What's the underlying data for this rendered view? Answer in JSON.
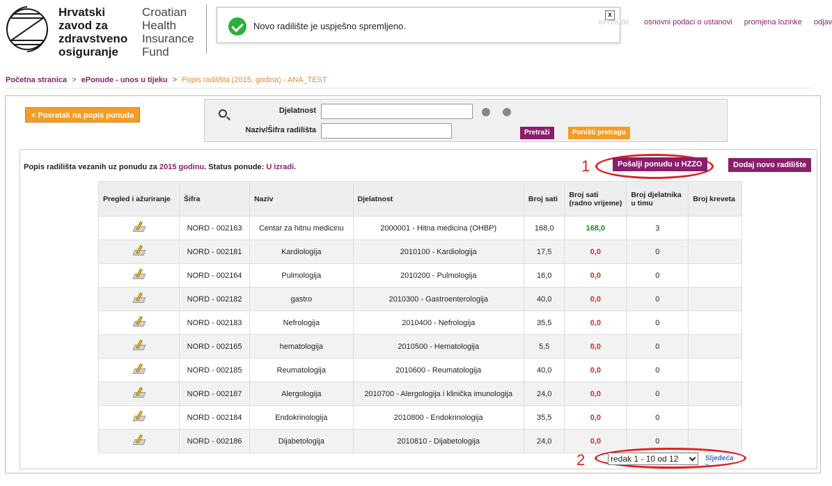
{
  "header": {
    "logo_hr": [
      "Hrvatski",
      "zavod za",
      "zdravstveno",
      "osiguranje"
    ],
    "logo_en": [
      "Croatian",
      "Health",
      "Insurance",
      "Fund"
    ],
    "toplinks": {
      "faded": "ePonude",
      "institution": "osnovni podaci o ustanovi",
      "password": "promjena lozinke",
      "logout": "odjava"
    }
  },
  "toast": {
    "message": "Novo radilište je uspješno spremljeno.",
    "close": "x"
  },
  "breadcrumb": {
    "home": "Početna stranica",
    "sep": ">",
    "offers": "ePonude - unos u tijeku",
    "current": "Popis radilišta (2015. godina) - ANA_TEST"
  },
  "back_button": "< Povratak na popis ponuda",
  "search": {
    "label_activity": "Djelatnost",
    "label_name": "Naziv/Šifra radilišta",
    "activity_value": "",
    "name_value": "",
    "search_btn": "Pretraži",
    "reset_btn": "Poništi pretragu"
  },
  "list": {
    "title_prefix": "Popis radilišta vezanih uz ponudu za ",
    "year": "2015 godinu",
    "title_mid": ". Status ponude: ",
    "status": "U izradi.",
    "send_btn": "Pošalji ponudu u HZZO",
    "add_btn": "Dodaj novo radilište"
  },
  "annotations": {
    "one": "1",
    "two": "2"
  },
  "table": {
    "headers": [
      "Pregled i ažuriranje",
      "Šifra",
      "Naziv",
      "Djelatnost",
      "Broj sati",
      "Broj sati (radno vrijeme)",
      "Broj djelatnika u timu",
      "Broj kreveta"
    ],
    "rows": [
      [
        "NORD - 002163",
        "Centar za hitnu medicinu",
        "2000001 - Hitna medicina (OHBP)",
        "168,0",
        "168,0",
        "3",
        ""
      ],
      [
        "NORD - 002181",
        "Kardiologija",
        "2010100 - Kardiologija",
        "17,5",
        "0,0",
        "0",
        ""
      ],
      [
        "NORD - 002164",
        "Pulmologija",
        "2010200 - Pulmologija",
        "16,0",
        "0,0",
        "0",
        ""
      ],
      [
        "NORD - 002182",
        "gastro",
        "2010300 - Gastroenterologija",
        "40,0",
        "0,0",
        "0",
        ""
      ],
      [
        "NORD - 002183",
        "Nefrologija",
        "2010400 - Nefrologija",
        "35,5",
        "0,0",
        "0",
        ""
      ],
      [
        "NORD - 002165",
        "hematologija",
        "2010500 - Hematologija",
        "5,5",
        "0,0",
        "0",
        ""
      ],
      [
        "NORD - 002185",
        "Reumatologija",
        "2010600 - Reumatologija",
        "40,0",
        "0,0",
        "0",
        ""
      ],
      [
        "NORD - 002187",
        "Alergologija",
        "2010700 - Alergologija i klinička imunologija",
        "24,0",
        "0,0",
        "0",
        ""
      ],
      [
        "NORD - 002184",
        "Endokrinologija",
        "2010800 - Endokrinologija",
        "35,5",
        "0,0",
        "0",
        ""
      ],
      [
        "NORD - 002186",
        "Dijabetologija",
        "2010810 - Dijabetologija",
        "24,0",
        "0,0",
        "0",
        ""
      ]
    ]
  },
  "pager": {
    "selected": "redak 1 - 10 od 12",
    "next": "Sljedeća >"
  },
  "colors": {
    "brand": "#8a1e6b",
    "accent": "#f39c26",
    "success": "#2eae3b",
    "annotation": "#e01e1e"
  }
}
